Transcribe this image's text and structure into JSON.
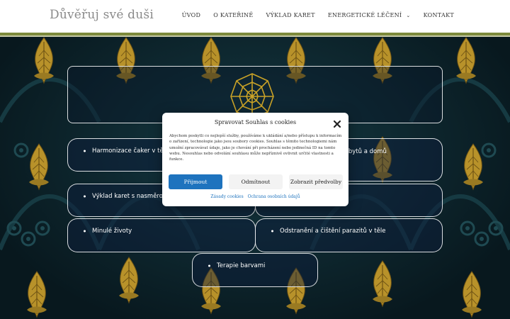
{
  "header": {
    "site_title": "Důvěřuj své duši",
    "nav": [
      {
        "label": "Úvod"
      },
      {
        "label": "O Kateřině"
      },
      {
        "label": "Výklad karet"
      },
      {
        "label": "Energetické léčení",
        "has_submenu": true
      },
      {
        "label": "Kontakt"
      }
    ]
  },
  "services": [
    "Harmonizace čaker v těle",
    "Harmonizace prostorů bytů a domů",
    "Výklad karet s nasměrováním",
    "Minulé životy",
    "Odstranění a čištění parazitů v těle",
    "Terapie barvami"
  ],
  "cookie_dialog": {
    "title": "Spravovat Souhlas s cookies",
    "body": "Abychom poskytli co nejlepší služby, používáme k ukládání a/nebo přístupu k informacím o zařízení, technologie jako jsou soubory cookies. Souhlas s těmito technologiemi nám umožní zpracovávat údaje, jako je chování při procházení nebo jedinečná ID na tomto webu. Nesouhlas nebo odvolání souhlasu může nepříznivě ovlivnit určité vlastnosti a funkce.",
    "accept_label": "Přijmout",
    "deny_label": "Odmítnout",
    "prefs_label": "Zobrazit předvolby",
    "link_cookies": "Zásady cookies",
    "link_privacy": "Ochrana osobních údajů"
  },
  "colors": {
    "accent_bar": "#7d8a3c",
    "primary_button": "#1e73be",
    "ornament_gold": "#c9a227"
  }
}
